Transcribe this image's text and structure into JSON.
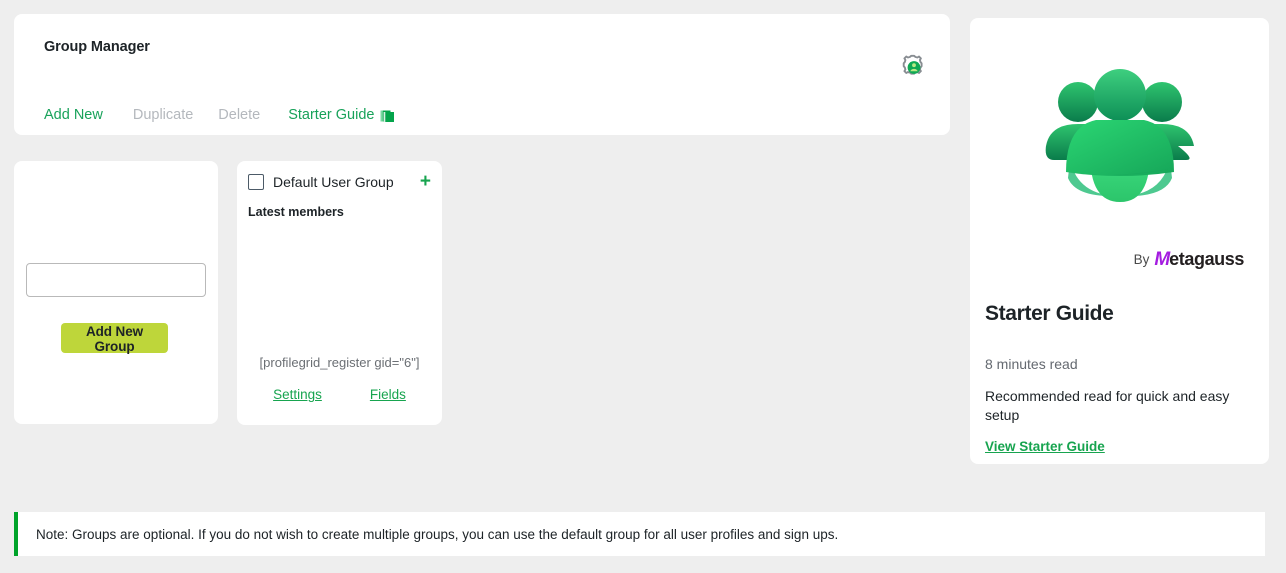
{
  "header": {
    "title": "Group Manager",
    "settings_icon": "gear-user-icon",
    "toolbar": {
      "add_new": "Add New",
      "duplicate": "Duplicate",
      "delete": "Delete",
      "starter_guide": "Starter Guide",
      "starter_guide_icon": "green-book-icon"
    }
  },
  "add_group_card": {
    "input_value": "",
    "input_placeholder": "",
    "button_label": "Add New Group",
    "button_color": "#bed63a"
  },
  "group_card": {
    "checkbox_checked": false,
    "name": "Default User Group",
    "add_icon": "plus-icon",
    "latest_members_label": "Latest members",
    "shortcode": "[profilegrid_register gid=\"6\"]",
    "settings_link": "Settings",
    "fields_link": "Fields"
  },
  "sidebar": {
    "logo": "profilegrid-people-logo",
    "by_label": "By",
    "brand_m": "M",
    "brand_rest": "etagauss",
    "title": "Starter Guide",
    "read_time": "8 minutes read",
    "description": "Recommended read for quick and easy setup",
    "link": "View Starter Guide"
  },
  "note": {
    "text": "Note: Groups are optional. If you do not wish to create multiple groups, you can use the default group for all user profiles and sign ups.",
    "accent_color": "#00a32a"
  },
  "colors": {
    "page_bg": "#eeeeee",
    "card_bg": "#ffffff",
    "green_link": "#18a25a",
    "disabled_text": "#b4b8bd",
    "brand_purple": "#a41ce0"
  }
}
